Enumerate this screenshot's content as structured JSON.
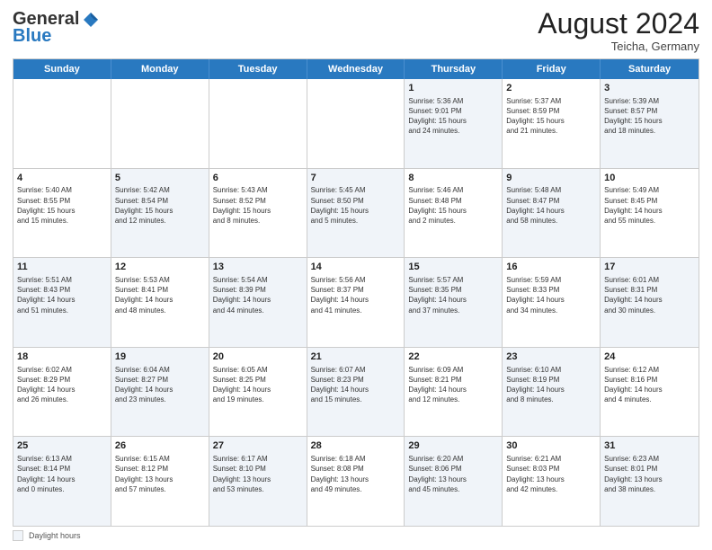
{
  "logo": {
    "line1": "General",
    "line2": "Blue"
  },
  "title": "August 2024",
  "location": "Teicha, Germany",
  "weekdays": [
    "Sunday",
    "Monday",
    "Tuesday",
    "Wednesday",
    "Thursday",
    "Friday",
    "Saturday"
  ],
  "footer": {
    "legend_label": "Daylight hours"
  },
  "rows": [
    [
      {
        "num": "",
        "text": "",
        "shaded": false,
        "empty": true
      },
      {
        "num": "",
        "text": "",
        "shaded": false,
        "empty": true
      },
      {
        "num": "",
        "text": "",
        "shaded": false,
        "empty": true
      },
      {
        "num": "",
        "text": "",
        "shaded": false,
        "empty": true
      },
      {
        "num": "1",
        "text": "Sunrise: 5:36 AM\nSunset: 9:01 PM\nDaylight: 15 hours\nand 24 minutes.",
        "shaded": true
      },
      {
        "num": "2",
        "text": "Sunrise: 5:37 AM\nSunset: 8:59 PM\nDaylight: 15 hours\nand 21 minutes.",
        "shaded": false
      },
      {
        "num": "3",
        "text": "Sunrise: 5:39 AM\nSunset: 8:57 PM\nDaylight: 15 hours\nand 18 minutes.",
        "shaded": true
      }
    ],
    [
      {
        "num": "4",
        "text": "Sunrise: 5:40 AM\nSunset: 8:55 PM\nDaylight: 15 hours\nand 15 minutes.",
        "shaded": false
      },
      {
        "num": "5",
        "text": "Sunrise: 5:42 AM\nSunset: 8:54 PM\nDaylight: 15 hours\nand 12 minutes.",
        "shaded": true
      },
      {
        "num": "6",
        "text": "Sunrise: 5:43 AM\nSunset: 8:52 PM\nDaylight: 15 hours\nand 8 minutes.",
        "shaded": false
      },
      {
        "num": "7",
        "text": "Sunrise: 5:45 AM\nSunset: 8:50 PM\nDaylight: 15 hours\nand 5 minutes.",
        "shaded": true
      },
      {
        "num": "8",
        "text": "Sunrise: 5:46 AM\nSunset: 8:48 PM\nDaylight: 15 hours\nand 2 minutes.",
        "shaded": false
      },
      {
        "num": "9",
        "text": "Sunrise: 5:48 AM\nSunset: 8:47 PM\nDaylight: 14 hours\nand 58 minutes.",
        "shaded": true
      },
      {
        "num": "10",
        "text": "Sunrise: 5:49 AM\nSunset: 8:45 PM\nDaylight: 14 hours\nand 55 minutes.",
        "shaded": false
      }
    ],
    [
      {
        "num": "11",
        "text": "Sunrise: 5:51 AM\nSunset: 8:43 PM\nDaylight: 14 hours\nand 51 minutes.",
        "shaded": true
      },
      {
        "num": "12",
        "text": "Sunrise: 5:53 AM\nSunset: 8:41 PM\nDaylight: 14 hours\nand 48 minutes.",
        "shaded": false
      },
      {
        "num": "13",
        "text": "Sunrise: 5:54 AM\nSunset: 8:39 PM\nDaylight: 14 hours\nand 44 minutes.",
        "shaded": true
      },
      {
        "num": "14",
        "text": "Sunrise: 5:56 AM\nSunset: 8:37 PM\nDaylight: 14 hours\nand 41 minutes.",
        "shaded": false
      },
      {
        "num": "15",
        "text": "Sunrise: 5:57 AM\nSunset: 8:35 PM\nDaylight: 14 hours\nand 37 minutes.",
        "shaded": true
      },
      {
        "num": "16",
        "text": "Sunrise: 5:59 AM\nSunset: 8:33 PM\nDaylight: 14 hours\nand 34 minutes.",
        "shaded": false
      },
      {
        "num": "17",
        "text": "Sunrise: 6:01 AM\nSunset: 8:31 PM\nDaylight: 14 hours\nand 30 minutes.",
        "shaded": true
      }
    ],
    [
      {
        "num": "18",
        "text": "Sunrise: 6:02 AM\nSunset: 8:29 PM\nDaylight: 14 hours\nand 26 minutes.",
        "shaded": false
      },
      {
        "num": "19",
        "text": "Sunrise: 6:04 AM\nSunset: 8:27 PM\nDaylight: 14 hours\nand 23 minutes.",
        "shaded": true
      },
      {
        "num": "20",
        "text": "Sunrise: 6:05 AM\nSunset: 8:25 PM\nDaylight: 14 hours\nand 19 minutes.",
        "shaded": false
      },
      {
        "num": "21",
        "text": "Sunrise: 6:07 AM\nSunset: 8:23 PM\nDaylight: 14 hours\nand 15 minutes.",
        "shaded": true
      },
      {
        "num": "22",
        "text": "Sunrise: 6:09 AM\nSunset: 8:21 PM\nDaylight: 14 hours\nand 12 minutes.",
        "shaded": false
      },
      {
        "num": "23",
        "text": "Sunrise: 6:10 AM\nSunset: 8:19 PM\nDaylight: 14 hours\nand 8 minutes.",
        "shaded": true
      },
      {
        "num": "24",
        "text": "Sunrise: 6:12 AM\nSunset: 8:16 PM\nDaylight: 14 hours\nand 4 minutes.",
        "shaded": false
      }
    ],
    [
      {
        "num": "25",
        "text": "Sunrise: 6:13 AM\nSunset: 8:14 PM\nDaylight: 14 hours\nand 0 minutes.",
        "shaded": true
      },
      {
        "num": "26",
        "text": "Sunrise: 6:15 AM\nSunset: 8:12 PM\nDaylight: 13 hours\nand 57 minutes.",
        "shaded": false
      },
      {
        "num": "27",
        "text": "Sunrise: 6:17 AM\nSunset: 8:10 PM\nDaylight: 13 hours\nand 53 minutes.",
        "shaded": true
      },
      {
        "num": "28",
        "text": "Sunrise: 6:18 AM\nSunset: 8:08 PM\nDaylight: 13 hours\nand 49 minutes.",
        "shaded": false
      },
      {
        "num": "29",
        "text": "Sunrise: 6:20 AM\nSunset: 8:06 PM\nDaylight: 13 hours\nand 45 minutes.",
        "shaded": true
      },
      {
        "num": "30",
        "text": "Sunrise: 6:21 AM\nSunset: 8:03 PM\nDaylight: 13 hours\nand 42 minutes.",
        "shaded": false
      },
      {
        "num": "31",
        "text": "Sunrise: 6:23 AM\nSunset: 8:01 PM\nDaylight: 13 hours\nand 38 minutes.",
        "shaded": true
      }
    ]
  ]
}
